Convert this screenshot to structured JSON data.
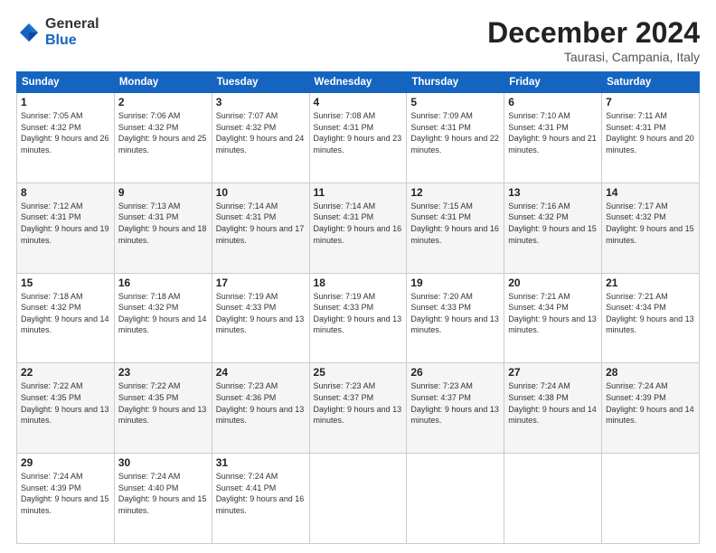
{
  "logo": {
    "general": "General",
    "blue": "Blue"
  },
  "header": {
    "month": "December 2024",
    "location": "Taurasi, Campania, Italy"
  },
  "weekdays": [
    "Sunday",
    "Monday",
    "Tuesday",
    "Wednesday",
    "Thursday",
    "Friday",
    "Saturday"
  ],
  "weeks": [
    [
      {
        "day": "1",
        "sunrise": "7:05 AM",
        "sunset": "4:32 PM",
        "daylight": "9 hours and 26 minutes."
      },
      {
        "day": "2",
        "sunrise": "7:06 AM",
        "sunset": "4:32 PM",
        "daylight": "9 hours and 25 minutes."
      },
      {
        "day": "3",
        "sunrise": "7:07 AM",
        "sunset": "4:32 PM",
        "daylight": "9 hours and 24 minutes."
      },
      {
        "day": "4",
        "sunrise": "7:08 AM",
        "sunset": "4:31 PM",
        "daylight": "9 hours and 23 minutes."
      },
      {
        "day": "5",
        "sunrise": "7:09 AM",
        "sunset": "4:31 PM",
        "daylight": "9 hours and 22 minutes."
      },
      {
        "day": "6",
        "sunrise": "7:10 AM",
        "sunset": "4:31 PM",
        "daylight": "9 hours and 21 minutes."
      },
      {
        "day": "7",
        "sunrise": "7:11 AM",
        "sunset": "4:31 PM",
        "daylight": "9 hours and 20 minutes."
      }
    ],
    [
      {
        "day": "8",
        "sunrise": "7:12 AM",
        "sunset": "4:31 PM",
        "daylight": "9 hours and 19 minutes."
      },
      {
        "day": "9",
        "sunrise": "7:13 AM",
        "sunset": "4:31 PM",
        "daylight": "9 hours and 18 minutes."
      },
      {
        "day": "10",
        "sunrise": "7:14 AM",
        "sunset": "4:31 PM",
        "daylight": "9 hours and 17 minutes."
      },
      {
        "day": "11",
        "sunrise": "7:14 AM",
        "sunset": "4:31 PM",
        "daylight": "9 hours and 16 minutes."
      },
      {
        "day": "12",
        "sunrise": "7:15 AM",
        "sunset": "4:31 PM",
        "daylight": "9 hours and 16 minutes."
      },
      {
        "day": "13",
        "sunrise": "7:16 AM",
        "sunset": "4:32 PM",
        "daylight": "9 hours and 15 minutes."
      },
      {
        "day": "14",
        "sunrise": "7:17 AM",
        "sunset": "4:32 PM",
        "daylight": "9 hours and 15 minutes."
      }
    ],
    [
      {
        "day": "15",
        "sunrise": "7:18 AM",
        "sunset": "4:32 PM",
        "daylight": "9 hours and 14 minutes."
      },
      {
        "day": "16",
        "sunrise": "7:18 AM",
        "sunset": "4:32 PM",
        "daylight": "9 hours and 14 minutes."
      },
      {
        "day": "17",
        "sunrise": "7:19 AM",
        "sunset": "4:33 PM",
        "daylight": "9 hours and 13 minutes."
      },
      {
        "day": "18",
        "sunrise": "7:19 AM",
        "sunset": "4:33 PM",
        "daylight": "9 hours and 13 minutes."
      },
      {
        "day": "19",
        "sunrise": "7:20 AM",
        "sunset": "4:33 PM",
        "daylight": "9 hours and 13 minutes."
      },
      {
        "day": "20",
        "sunrise": "7:21 AM",
        "sunset": "4:34 PM",
        "daylight": "9 hours and 13 minutes."
      },
      {
        "day": "21",
        "sunrise": "7:21 AM",
        "sunset": "4:34 PM",
        "daylight": "9 hours and 13 minutes."
      }
    ],
    [
      {
        "day": "22",
        "sunrise": "7:22 AM",
        "sunset": "4:35 PM",
        "daylight": "9 hours and 13 minutes."
      },
      {
        "day": "23",
        "sunrise": "7:22 AM",
        "sunset": "4:35 PM",
        "daylight": "9 hours and 13 minutes."
      },
      {
        "day": "24",
        "sunrise": "7:23 AM",
        "sunset": "4:36 PM",
        "daylight": "9 hours and 13 minutes."
      },
      {
        "day": "25",
        "sunrise": "7:23 AM",
        "sunset": "4:37 PM",
        "daylight": "9 hours and 13 minutes."
      },
      {
        "day": "26",
        "sunrise": "7:23 AM",
        "sunset": "4:37 PM",
        "daylight": "9 hours and 13 minutes."
      },
      {
        "day": "27",
        "sunrise": "7:24 AM",
        "sunset": "4:38 PM",
        "daylight": "9 hours and 14 minutes."
      },
      {
        "day": "28",
        "sunrise": "7:24 AM",
        "sunset": "4:39 PM",
        "daylight": "9 hours and 14 minutes."
      }
    ],
    [
      {
        "day": "29",
        "sunrise": "7:24 AM",
        "sunset": "4:39 PM",
        "daylight": "9 hours and 15 minutes."
      },
      {
        "day": "30",
        "sunrise": "7:24 AM",
        "sunset": "4:40 PM",
        "daylight": "9 hours and 15 minutes."
      },
      {
        "day": "31",
        "sunrise": "7:24 AM",
        "sunset": "4:41 PM",
        "daylight": "9 hours and 16 minutes."
      },
      null,
      null,
      null,
      null
    ]
  ],
  "labels": {
    "sunrise": "Sunrise:",
    "sunset": "Sunset:",
    "daylight": "Daylight:"
  }
}
